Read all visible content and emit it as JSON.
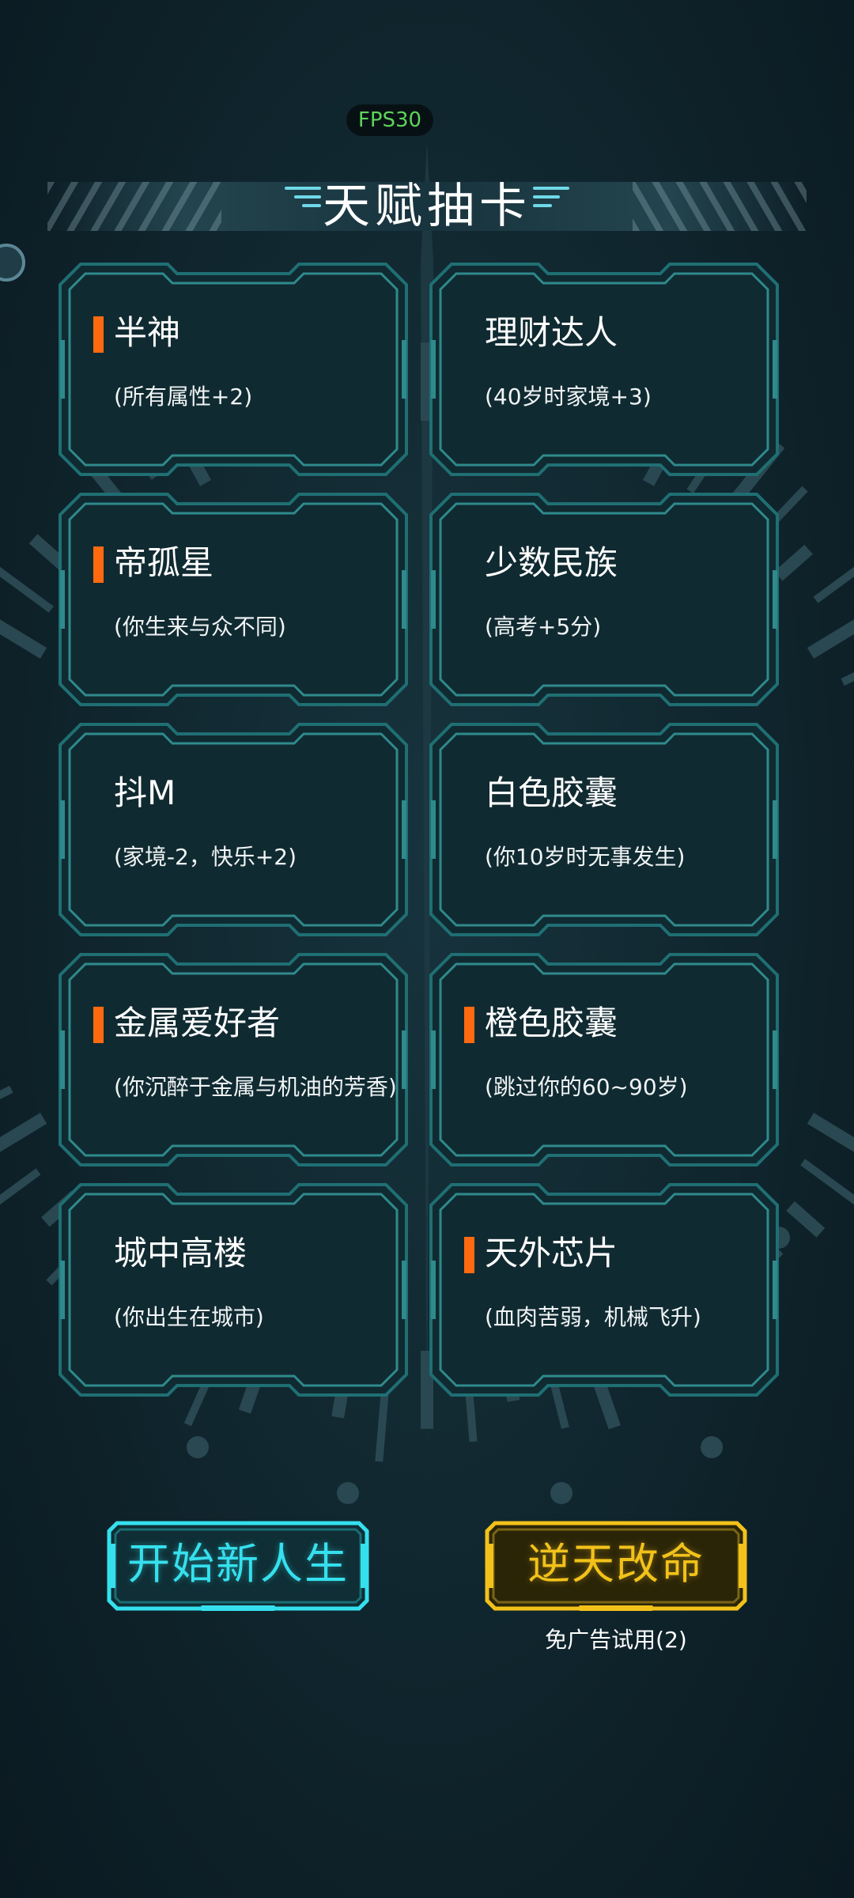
{
  "fps": "FPS30",
  "title": "天赋抽卡",
  "colors": {
    "background": "#0d1f27",
    "card_frame": "#1f6f73",
    "card_fill": "#102a31",
    "rarity_flag": "#ff6a10",
    "start_button": "#35e0ee",
    "revive_button": "#f2c21a"
  },
  "talents": [
    {
      "name": "半神",
      "desc": "(所有属性+2)",
      "highlighted": true
    },
    {
      "name": "理财达人",
      "desc": "(40岁时家境+3)",
      "highlighted": false
    },
    {
      "name": "帝孤星",
      "desc": "(你生来与众不同)",
      "highlighted": true
    },
    {
      "name": "少数民族",
      "desc": "(高考+5分)",
      "highlighted": false
    },
    {
      "name": "抖M",
      "desc": "(家境-2，快乐+2)",
      "highlighted": false
    },
    {
      "name": "白色胶囊",
      "desc": "(你10岁时无事发生)",
      "highlighted": false
    },
    {
      "name": "金属爱好者",
      "desc": "(你沉醉于金属与机油的芳香)",
      "highlighted": true
    },
    {
      "name": "橙色胶囊",
      "desc": "(跳过你的60~90岁)",
      "highlighted": true
    },
    {
      "name": "城中高楼",
      "desc": "(你出生在城市)",
      "highlighted": false
    },
    {
      "name": "天外芯片",
      "desc": "(血肉苦弱，机械飞升)",
      "highlighted": true
    }
  ],
  "buttons": {
    "start": "开始新人生",
    "revive": "逆天改命",
    "ad_trial": "免广告试用(2)"
  }
}
